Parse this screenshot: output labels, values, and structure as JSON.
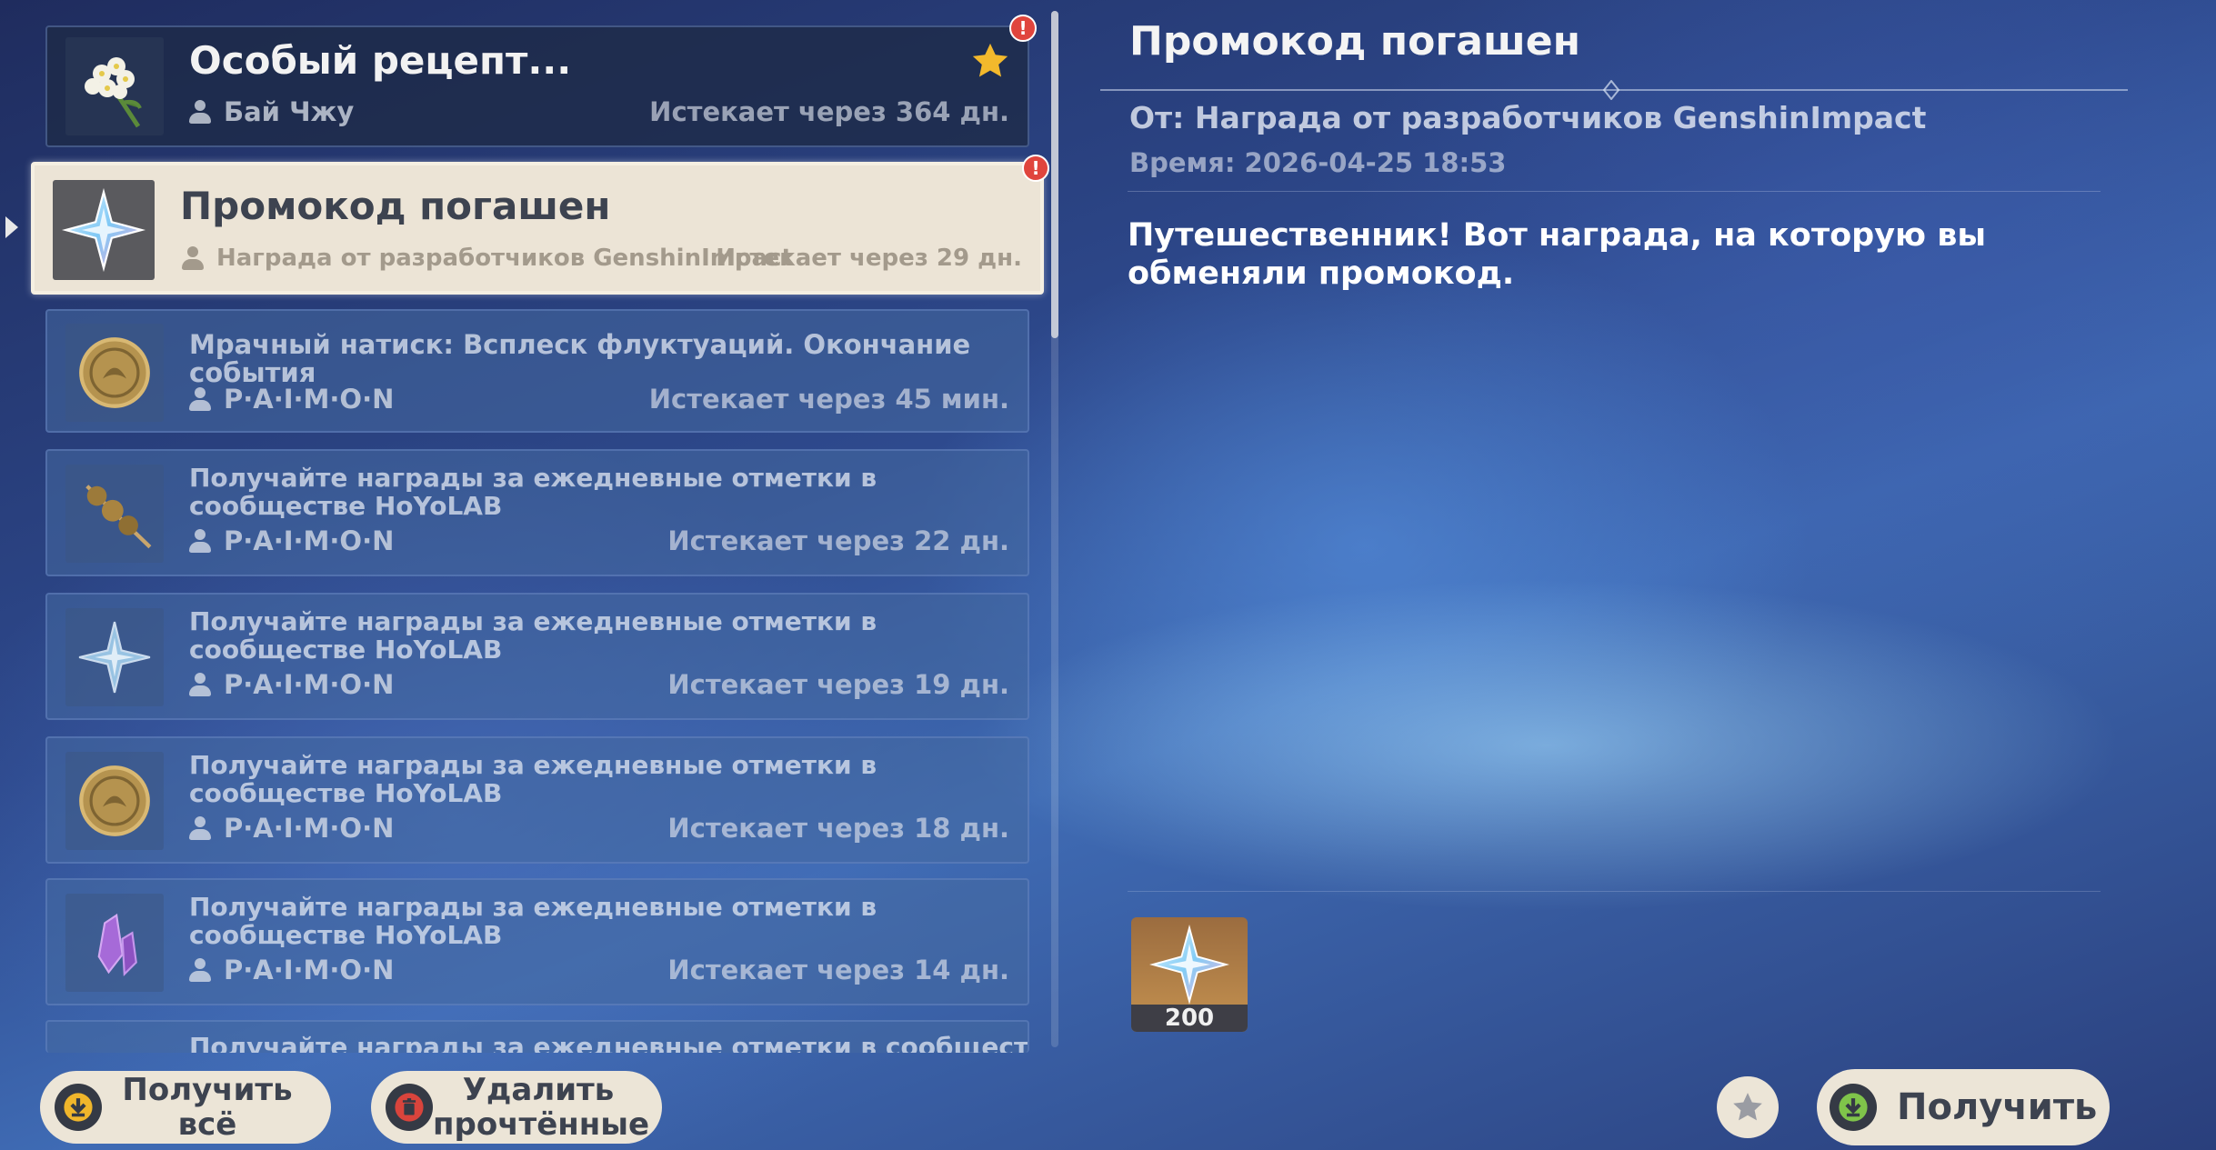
{
  "mail_list": [
    {
      "title": "Особый рецепт...",
      "sender": "Бай Чжу",
      "expires": "Истекает через 364 дн.",
      "icon": "flower-icon",
      "starred": true,
      "unread": true,
      "state": "dark"
    },
    {
      "title": "Промокод погашен",
      "sender": "Награда от разработчиков GenshinImpact",
      "expires": "Истекает через 29 дн.",
      "icon": "primogem-icon",
      "starred": false,
      "unread": true,
      "state": "selected"
    },
    {
      "title": "Мрачный натиск: Всплеск флуктуаций. Окончание события",
      "sender": "P·A·I·M·O·N",
      "expires": "Истекает через 45 мин.",
      "icon": "mora-coin-icon",
      "state": "read"
    },
    {
      "title": "Получайте награды за ежедневные отметки в сообществе HoYoLAB",
      "sender": "P·A·I·M·O·N",
      "expires": "Истекает через 22 дн.",
      "icon": "skewer-food-icon",
      "state": "read"
    },
    {
      "title": "Получайте награды за ежедневные отметки в сообществе HoYoLAB",
      "sender": "P·A·I·M·O·N",
      "expires": "Истекает через 19 дн.",
      "icon": "primogem-icon",
      "state": "read"
    },
    {
      "title": "Получайте награды за ежедневные отметки в сообществе HoYoLAB",
      "sender": "P·A·I·M·O·N",
      "expires": "Истекает через 18 дн.",
      "icon": "mora-coin-icon",
      "state": "read"
    },
    {
      "title": "Получайте награды за ежедневные отметки в сообществе HoYoLAB",
      "sender": "P·A·I·M·O·N",
      "expires": "Истекает через 14 дн.",
      "icon": "crystal-icon",
      "state": "read"
    },
    {
      "title": "Получайте награды за ежедневные отметки в сообществе",
      "state": "read"
    }
  ],
  "notification_mark": "!",
  "buttons": {
    "claim_all": "Получить всё",
    "delete_read": "Удалить прочтённые",
    "claim": "Получить"
  },
  "detail": {
    "title": "Промокод погашен",
    "from": "От: Награда от разработчиков GenshinImpact",
    "time": "Время: 2026-04-25 18:53",
    "body": "Путешественник! Вот награда, на которую вы обменяли промокод.",
    "reward": {
      "icon": "primogem-icon",
      "count": "200"
    }
  },
  "colors": {
    "accent_star": "#f3b92c",
    "notif_red": "#e0453d",
    "button_bg": "#ece5d7",
    "claim_green": "#7fc44a",
    "delete_red": "#d9443c"
  }
}
